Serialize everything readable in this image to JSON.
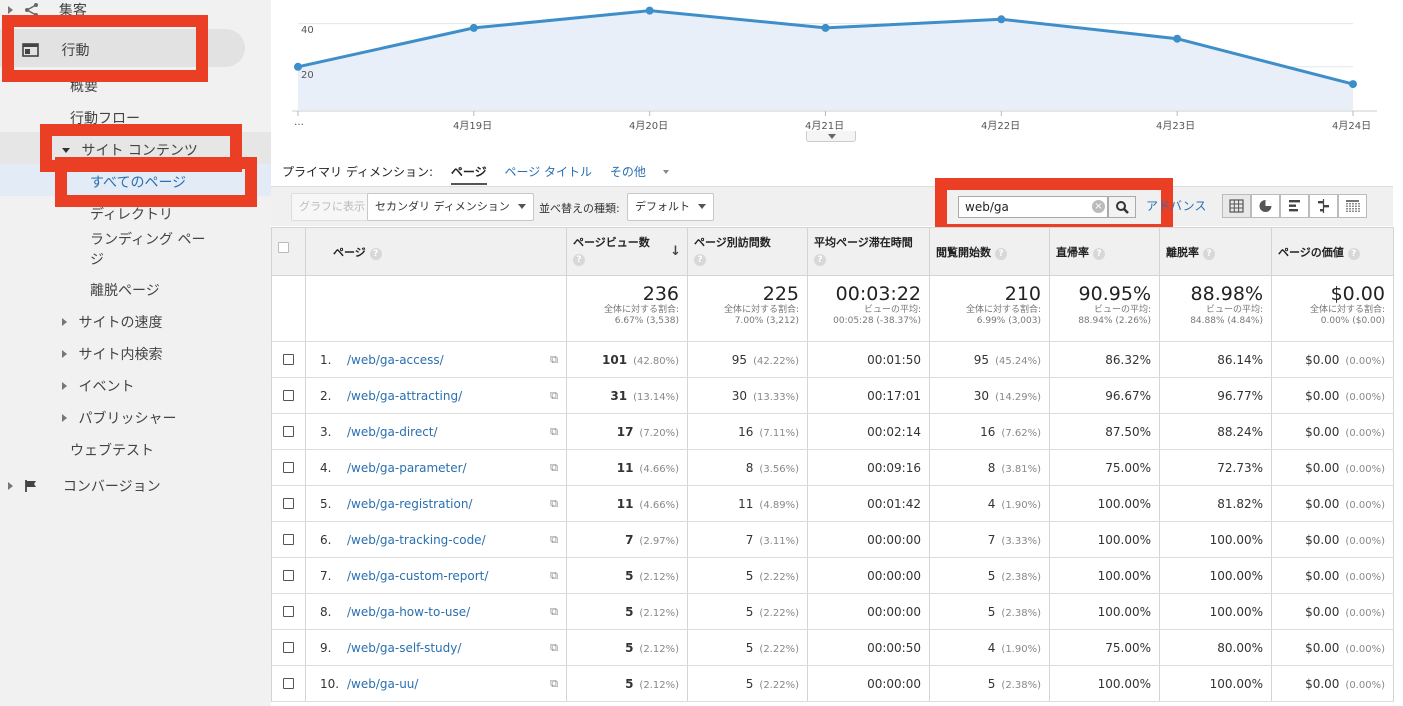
{
  "sidebar": {
    "items": [
      {
        "label": "集客"
      },
      {
        "label": "行動"
      },
      {
        "label": "概要"
      },
      {
        "label": "行動フロー"
      },
      {
        "label": "サイト コンテンツ"
      },
      {
        "label": "すべてのページ"
      },
      {
        "label": "ディレクトリ"
      },
      {
        "label": "ランディング ページ"
      },
      {
        "label": "離脱ページ"
      },
      {
        "label": "サイトの速度"
      },
      {
        "label": "サイト内検索"
      },
      {
        "label": "イベント"
      },
      {
        "label": "パブリッシャー"
      },
      {
        "label": "ウェブテスト"
      },
      {
        "label": "コンバージョン"
      }
    ]
  },
  "chart": {
    "y_ticks": [
      "40",
      "20"
    ],
    "x_ticks": [
      "…",
      "4月19日",
      "4月20日",
      "4月21日",
      "4月22日",
      "4月23日",
      "4月24日"
    ],
    "values": [
      20,
      38,
      46,
      38,
      42,
      33,
      12
    ],
    "ylim": [
      0,
      50
    ],
    "line_color": "#3d8ec9",
    "fill_color": "#e8eff8"
  },
  "dimension": {
    "label": "プライマリ ディメンション:",
    "active": "ページ",
    "links": [
      "ページ タイトル",
      "その他"
    ]
  },
  "toolbar": {
    "plot_button": "グラフに表示",
    "secondary_dimension": "セカンダリ ディメンション",
    "sort_label": "並べ替えの種類:",
    "sort_value": "デフォルト",
    "search_value": "web/ga",
    "advanced_link": "アドバンス"
  },
  "table": {
    "headers": {
      "page": "ページ",
      "pageviews": "ページビュー数",
      "unique": "ページ別訪問数",
      "avg_time": "平均ページ滞在時間",
      "entrances": "閲覧開始数",
      "bounce": "直帰率",
      "exit": "離脱率",
      "value": "ページの価値"
    },
    "totals": {
      "pageviews": "236",
      "pageviews_sub1": "全体に対する割合:",
      "pageviews_sub2": "6.67% (3,538)",
      "unique": "225",
      "unique_sub1": "全体に対する割合:",
      "unique_sub2": "7.00% (3,212)",
      "avg_time": "00:03:22",
      "avg_time_sub1": "ビューの平均:",
      "avg_time_sub2": "00:05:28 (-38.37%)",
      "entrances": "210",
      "entrances_sub1": "全体に対する割合:",
      "entrances_sub2": "6.99% (3,003)",
      "bounce": "90.95%",
      "bounce_sub1": "ビューの平均:",
      "bounce_sub2": "88.94% (2.26%)",
      "exit": "88.98%",
      "exit_sub1": "ビューの平均:",
      "exit_sub2": "84.88% (4.84%)",
      "value": "$0.00",
      "value_sub1": "全体に対する割合:",
      "value_sub2": "0.00% ($0.00)"
    },
    "rows": [
      {
        "idx": "1.",
        "page": "/web/ga-access/",
        "pv": "101",
        "pv_pct": "(42.80%)",
        "uv": "95",
        "uv_pct": "(42.22%)",
        "time": "00:01:50",
        "ent": "95",
        "ent_pct": "(45.24%)",
        "bounce": "86.32%",
        "exit": "86.14%",
        "val": "$0.00",
        "val_pct": "(0.00%)"
      },
      {
        "idx": "2.",
        "page": "/web/ga-attracting/",
        "pv": "31",
        "pv_pct": "(13.14%)",
        "uv": "30",
        "uv_pct": "(13.33%)",
        "time": "00:17:01",
        "ent": "30",
        "ent_pct": "(14.29%)",
        "bounce": "96.67%",
        "exit": "96.77%",
        "val": "$0.00",
        "val_pct": "(0.00%)"
      },
      {
        "idx": "3.",
        "page": "/web/ga-direct/",
        "pv": "17",
        "pv_pct": "(7.20%)",
        "uv": "16",
        "uv_pct": "(7.11%)",
        "time": "00:02:14",
        "ent": "16",
        "ent_pct": "(7.62%)",
        "bounce": "87.50%",
        "exit": "88.24%",
        "val": "$0.00",
        "val_pct": "(0.00%)"
      },
      {
        "idx": "4.",
        "page": "/web/ga-parameter/",
        "pv": "11",
        "pv_pct": "(4.66%)",
        "uv": "8",
        "uv_pct": "(3.56%)",
        "time": "00:09:16",
        "ent": "8",
        "ent_pct": "(3.81%)",
        "bounce": "75.00%",
        "exit": "72.73%",
        "val": "$0.00",
        "val_pct": "(0.00%)"
      },
      {
        "idx": "5.",
        "page": "/web/ga-registration/",
        "pv": "11",
        "pv_pct": "(4.66%)",
        "uv": "11",
        "uv_pct": "(4.89%)",
        "time": "00:01:42",
        "ent": "4",
        "ent_pct": "(1.90%)",
        "bounce": "100.00%",
        "exit": "81.82%",
        "val": "$0.00",
        "val_pct": "(0.00%)"
      },
      {
        "idx": "6.",
        "page": "/web/ga-tracking-code/",
        "pv": "7",
        "pv_pct": "(2.97%)",
        "uv": "7",
        "uv_pct": "(3.11%)",
        "time": "00:00:00",
        "ent": "7",
        "ent_pct": "(3.33%)",
        "bounce": "100.00%",
        "exit": "100.00%",
        "val": "$0.00",
        "val_pct": "(0.00%)"
      },
      {
        "idx": "7.",
        "page": "/web/ga-custom-report/",
        "pv": "5",
        "pv_pct": "(2.12%)",
        "uv": "5",
        "uv_pct": "(2.22%)",
        "time": "00:00:00",
        "ent": "5",
        "ent_pct": "(2.38%)",
        "bounce": "100.00%",
        "exit": "100.00%",
        "val": "$0.00",
        "val_pct": "(0.00%)"
      },
      {
        "idx": "8.",
        "page": "/web/ga-how-to-use/",
        "pv": "5",
        "pv_pct": "(2.12%)",
        "uv": "5",
        "uv_pct": "(2.22%)",
        "time": "00:00:00",
        "ent": "5",
        "ent_pct": "(2.38%)",
        "bounce": "100.00%",
        "exit": "100.00%",
        "val": "$0.00",
        "val_pct": "(0.00%)"
      },
      {
        "idx": "9.",
        "page": "/web/ga-self-study/",
        "pv": "5",
        "pv_pct": "(2.12%)",
        "uv": "5",
        "uv_pct": "(2.22%)",
        "time": "00:00:50",
        "ent": "4",
        "ent_pct": "(1.90%)",
        "bounce": "75.00%",
        "exit": "80.00%",
        "val": "$0.00",
        "val_pct": "(0.00%)"
      },
      {
        "idx": "10.",
        "page": "/web/ga-uu/",
        "pv": "5",
        "pv_pct": "(2.12%)",
        "uv": "5",
        "uv_pct": "(2.22%)",
        "time": "00:00:00",
        "ent": "5",
        "ent_pct": "(2.38%)",
        "bounce": "100.00%",
        "exit": "100.00%",
        "val": "$0.00",
        "val_pct": "(0.00%)"
      }
    ]
  },
  "icons": {
    "acquisition": "fork-icon",
    "behavior": "window-icon",
    "conversion": "flag-icon",
    "search": "magnifier-icon",
    "open_page": "external-window-icon"
  },
  "colors": {
    "highlight": "#ea3f25",
    "link": "#2a6fb0",
    "sidebar_bg": "#f1f1f1"
  }
}
